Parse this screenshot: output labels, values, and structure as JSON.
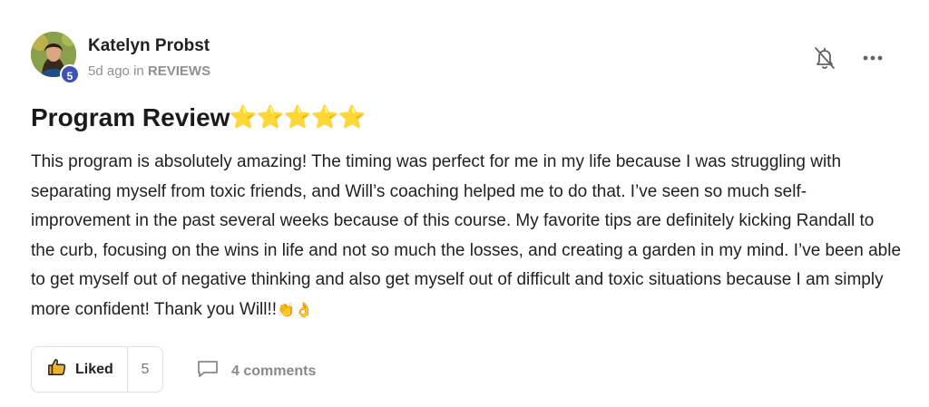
{
  "post": {
    "author": {
      "name": "Katelyn Probst",
      "level": "5"
    },
    "meta": {
      "time_ago": "5d ago",
      "in_word": "in",
      "category": "REVIEWS"
    },
    "title": "Program Review",
    "title_stars": "⭐⭐⭐⭐⭐",
    "body": "This program is absolutely amazing! The timing was perfect for me in my life because I was struggling with separating myself from toxic friends, and Will’s coaching helped me to do that. I’ve seen so much self-improvement in the past several weeks because of this course. My favorite tips are definitely kicking Randall to the curb, focusing on the wins in life and not so much the losses, and creating a garden in my mind. I’ve been able to get myself out of negative thinking and also get myself out of difficult and toxic situations because I am simply more confident! Thank you Will!!",
    "body_emojis": "👏👌",
    "actions": {
      "like_label": "Liked",
      "like_count": "5",
      "comments_label": "4 comments"
    },
    "icons": {
      "bell": "bell-off-icon",
      "more": "more-horizontal-icon",
      "thumb": "thumbs-up-icon",
      "comment": "comment-icon"
    },
    "colors": {
      "level_badge": "#3f51b5",
      "meta_text": "#909090",
      "star": "#f6c11f"
    }
  }
}
